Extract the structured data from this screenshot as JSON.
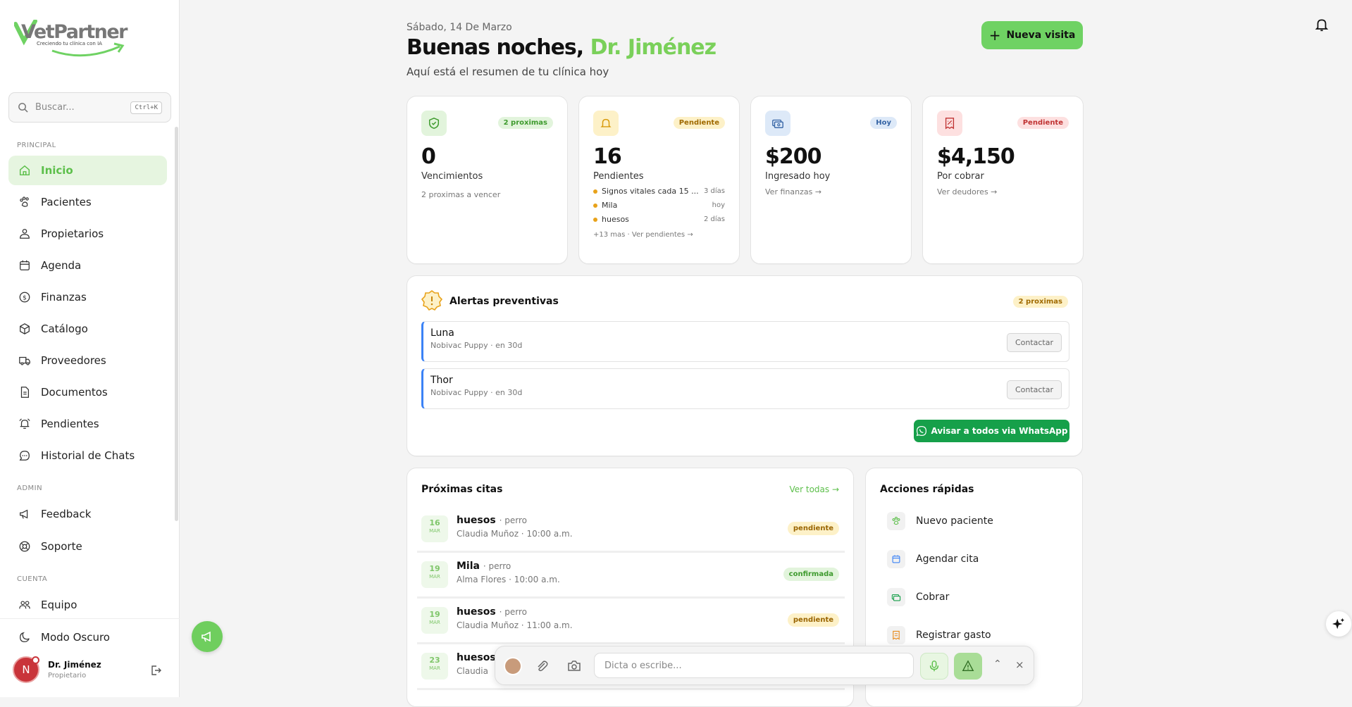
{
  "brand": {
    "name": "VetPartner",
    "tagline": "Creciendo tu clínica con IA"
  },
  "search": {
    "placeholder": "Buscar...",
    "shortcut": "Ctrl+K"
  },
  "sidebar": {
    "sections": {
      "principal": "PRINCIPAL",
      "admin": "ADMIN",
      "cuenta": "CUENTA"
    },
    "items": [
      {
        "label": "Inicio",
        "icon": "home-icon",
        "active": true
      },
      {
        "label": "Pacientes",
        "icon": "paw-icon"
      },
      {
        "label": "Propietarios",
        "icon": "owner-icon"
      },
      {
        "label": "Agenda",
        "icon": "calendar-icon"
      },
      {
        "label": "Finanzas",
        "icon": "dollar-icon"
      },
      {
        "label": "Catálogo",
        "icon": "box-icon"
      },
      {
        "label": "Proveedores",
        "icon": "truck-icon"
      },
      {
        "label": "Documentos",
        "icon": "document-icon"
      },
      {
        "label": "Pendientes",
        "icon": "alarm-icon"
      },
      {
        "label": "Historial de Chats",
        "icon": "chat-icon"
      }
    ],
    "admin_items": [
      {
        "label": "Feedback",
        "icon": "megaphone-icon"
      },
      {
        "label": "Soporte",
        "icon": "lifebuoy-icon"
      }
    ],
    "cuenta_items": [
      {
        "label": "Equipo",
        "icon": "team-icon"
      }
    ],
    "dark_mode": "Modo Oscuro",
    "user": {
      "initial": "N",
      "name": "Dr. Jiménez",
      "role": "Propietario"
    }
  },
  "header": {
    "date": "Sábado, 14 De Marzo",
    "greeting": "Buenas noches,",
    "doctor": "Dr. Jiménez",
    "subtitle": "Aquí está el resumen de tu clínica hoy",
    "new_visit": "Nueva visita"
  },
  "stats": {
    "vencimientos": {
      "badge": "2 proximas",
      "value": "0",
      "label": "Vencimientos",
      "sub": "2 proximas a vencer"
    },
    "pendientes": {
      "badge": "Pendiente",
      "value": "16",
      "label": "Pendientes",
      "items": [
        {
          "text": "Signos vitales cada 15 ...",
          "when": "3 días"
        },
        {
          "text": "Mila",
          "when": "hoy"
        },
        {
          "text": "huesos",
          "when": "2 días"
        }
      ],
      "more": "+13 mas · Ver pendientes →"
    },
    "ingresado": {
      "badge": "Hoy",
      "value": "$200",
      "label": "Ingresado hoy",
      "sub": "Ver finanzas →"
    },
    "cobrar": {
      "badge": "Pendiente",
      "value": "$4,150",
      "label": "Por cobrar",
      "sub": "Ver deudores →"
    }
  },
  "alerts": {
    "title": "Alertas preventivas",
    "badge": "2 proximas",
    "rows": [
      {
        "name": "Luna",
        "detail": "Nobivac Puppy · en 30d",
        "action": "Contactar"
      },
      {
        "name": "Thor",
        "detail": "Nobivac Puppy · en 30d",
        "action": "Contactar"
      }
    ],
    "whatsapp": "Avisar a todos via WhatsApp"
  },
  "citas": {
    "title": "Próximas citas",
    "see_all": "Ver todas →",
    "rows": [
      {
        "day": "16",
        "month": "MAR",
        "name": "huesos",
        "species": "· perro",
        "detail": "Claudia Muñoz · 10:00 a.m.",
        "status": "pendiente"
      },
      {
        "day": "19",
        "month": "MAR",
        "name": "Mila",
        "species": "· perro",
        "detail": "Alma Flores · 10:00 a.m.",
        "status": "confirmada"
      },
      {
        "day": "19",
        "month": "MAR",
        "name": "huesos",
        "species": "· perro",
        "detail": "Claudia Muñoz · 11:00 a.m.",
        "status": "pendiente"
      },
      {
        "day": "23",
        "month": "MAR",
        "name": "huesos",
        "species": "",
        "detail": "Claudia",
        "status": ""
      }
    ]
  },
  "acciones": {
    "title": "Acciones rápidas",
    "items": [
      {
        "label": "Nuevo paciente",
        "icon": "paw-icon"
      },
      {
        "label": "Agendar cita",
        "icon": "calendar-icon"
      },
      {
        "label": "Cobrar",
        "icon": "cash-icon"
      },
      {
        "label": "Registrar gasto",
        "icon": "receipt-icon"
      }
    ]
  },
  "voice": {
    "placeholder": "Dicta o escribe..."
  },
  "colors": {
    "accent": "#6fd263",
    "whatsapp": "#16a04a",
    "alert_border": "#3b82f6"
  }
}
